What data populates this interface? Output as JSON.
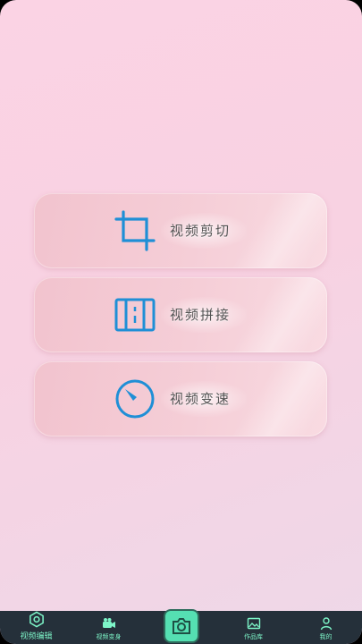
{
  "menu": {
    "items": [
      {
        "label": "视频剪切",
        "icon": "crop-icon"
      },
      {
        "label": "视频拼接",
        "icon": "film-strip-icon"
      },
      {
        "label": "视频变速",
        "icon": "speed-dial-icon"
      }
    ]
  },
  "tabbar": {
    "items": [
      {
        "label": "视频编辑",
        "icon": "hexagon-icon"
      },
      {
        "label": "视频变身",
        "icon": "video-camera-icon"
      },
      {
        "label": "",
        "icon": "camera-icon"
      },
      {
        "label": "作品库",
        "icon": "image-icon"
      },
      {
        "label": "我的",
        "icon": "person-icon"
      }
    ],
    "accent": "#55dfb2"
  },
  "colors": {
    "icon": "#1f8fd6",
    "tab_text": "#7df5c8",
    "tabbar_bg": "#25303a"
  }
}
